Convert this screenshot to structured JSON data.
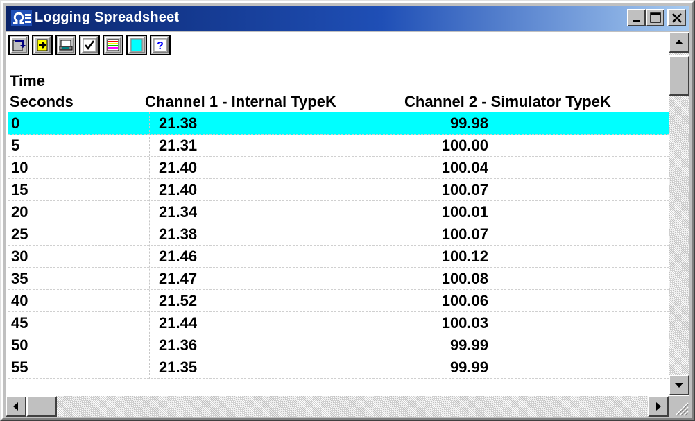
{
  "window": {
    "title": "Logging Spreadsheet",
    "app_icon": "omega-logo-icon",
    "caption_buttons": [
      "minimize-icon",
      "maximize-icon",
      "close-icon"
    ]
  },
  "toolbar": {
    "buttons": [
      {
        "icon": "export-icon"
      },
      {
        "icon": "import-icon"
      },
      {
        "icon": "print-icon"
      },
      {
        "icon": "check-icon"
      },
      {
        "icon": "colors-icon"
      },
      {
        "icon": "cyan-highlight-icon"
      },
      {
        "icon": "help-icon",
        "label": "?"
      }
    ]
  },
  "header": {
    "row1": {
      "col0": "Time"
    },
    "row2": {
      "col0": "Seconds",
      "col1": "Channel 1 - Internal TypeK",
      "col2": "Channel 2 - Simulator TypeK"
    }
  },
  "table": {
    "selected_row": 0,
    "highlight_color": "#00ffff",
    "rows": [
      [
        "0",
        "21.38",
        "99.98"
      ],
      [
        "5",
        "21.31",
        "100.00"
      ],
      [
        "10",
        "21.40",
        "100.04"
      ],
      [
        "15",
        "21.40",
        "100.07"
      ],
      [
        "20",
        "21.34",
        "100.01"
      ],
      [
        "25",
        "21.38",
        "100.07"
      ],
      [
        "30",
        "21.46",
        "100.12"
      ],
      [
        "35",
        "21.47",
        "100.08"
      ],
      [
        "40",
        "21.52",
        "100.06"
      ],
      [
        "45",
        "21.44",
        "100.03"
      ],
      [
        "50",
        "21.36",
        "99.99"
      ],
      [
        "55",
        "21.35",
        "99.99"
      ]
    ]
  },
  "colors": {
    "titlebar_start": "#0a246a",
    "titlebar_end": "#a6caf0",
    "chrome": "#c0c0c0"
  }
}
